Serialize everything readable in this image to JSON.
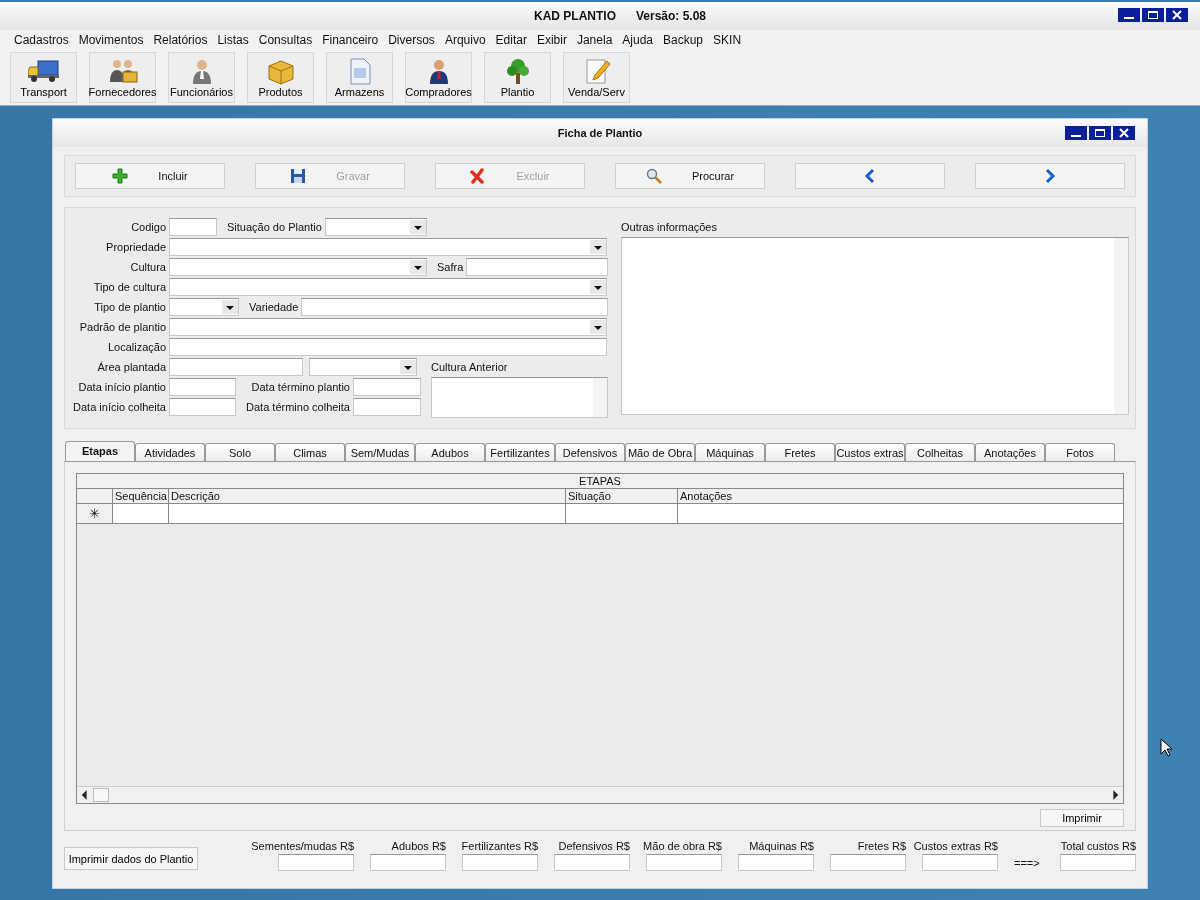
{
  "app": {
    "title": "KAD PLANTIO",
    "version": "Versão: 5.08"
  },
  "menu": [
    "Cadastros",
    "Movimentos",
    "Relatórios",
    "Listas",
    "Consultas",
    "Financeiro",
    "Diversos",
    "Arquivo",
    "Editar",
    "Exibir",
    "Janela",
    "Ajuda",
    "Backup",
    "SKIN"
  ],
  "toolbar": [
    "Transport",
    "Fornecedores",
    "Funcionários",
    "Produtos",
    "Armazens",
    "Compradores",
    "Plantio",
    "Venda/Serv"
  ],
  "window": {
    "title": "Ficha de Plantio"
  },
  "actions": [
    {
      "label": "Incluir",
      "disabled": false
    },
    {
      "label": "Gravar",
      "disabled": true
    },
    {
      "label": "Excluir",
      "disabled": true
    },
    {
      "label": "Procurar",
      "disabled": false
    },
    {
      "kind": "previous"
    },
    {
      "kind": "next"
    }
  ],
  "form": {
    "rows": [
      [
        {
          "kind": "label",
          "text": "Codigo"
        },
        {
          "kind": "field"
        },
        {
          "kind": "label",
          "text": "Situação do Plantio"
        },
        {
          "kind": "combo"
        }
      ],
      [
        {
          "kind": "label",
          "text": "Propriedade"
        },
        {
          "kind": "combo"
        }
      ],
      [
        {
          "kind": "label",
          "text": "Cultura"
        },
        {
          "kind": "combo"
        },
        {
          "kind": "label",
          "text": "Safra"
        },
        {
          "kind": "field"
        }
      ],
      [
        {
          "kind": "label",
          "text": "Tipo de cultura"
        },
        {
          "kind": "combo"
        }
      ],
      [
        {
          "kind": "label",
          "text": "Tipo de plantio"
        },
        {
          "kind": "combo"
        },
        {
          "kind": "label",
          "text": "Variedade"
        },
        {
          "kind": "field"
        }
      ],
      [
        {
          "kind": "label",
          "text": "Padrão de plantio"
        },
        {
          "kind": "combo"
        }
      ],
      [
        {
          "kind": "label",
          "text": "Localização"
        },
        {
          "kind": "field"
        }
      ]
    ],
    "lower_rows": [
      [
        {
          "kind": "label",
          "text": "Área plantada"
        },
        {
          "kind": "field"
        },
        {
          "kind": "combo"
        }
      ],
      [
        {
          "kind": "label",
          "text": "Data início plantio"
        },
        {
          "kind": "field"
        },
        {
          "kind": "label",
          "text": "Data término plantio"
        },
        {
          "kind": "field"
        }
      ],
      [
        {
          "kind": "label",
          "text": "Data início colheita"
        },
        {
          "kind": "field"
        },
        {
          "kind": "label",
          "text": "Data término colheita"
        },
        {
          "kind": "field"
        }
      ]
    ],
    "previous_crop_label": "Cultura Anterior",
    "notes_label": "Outras informações"
  },
  "tabs": [
    {
      "label": "Etapas",
      "selected": true
    },
    {
      "label": "Atividades",
      "selected": false
    },
    {
      "label": "Solo",
      "selected": false
    },
    {
      "label": "Climas",
      "selected": false
    },
    {
      "label": "Sem/Mudas",
      "selected": false
    },
    {
      "label": "Adubos",
      "selected": false
    },
    {
      "label": "Fertilizantes",
      "selected": false
    },
    {
      "label": "Defensivos",
      "selected": false
    },
    {
      "label": "Mão de Obra",
      "selected": false
    },
    {
      "label": "Máquinas",
      "selected": false
    },
    {
      "label": "Fretes",
      "selected": false
    },
    {
      "label": "Custos extras",
      "selected": false
    },
    {
      "label": "Colheitas",
      "selected": false
    },
    {
      "label": "Anotações",
      "selected": false
    },
    {
      "label": "Fotos",
      "selected": false
    }
  ],
  "grid": {
    "title": "ETAPAS",
    "columns": [
      "Sequência",
      "Descrição",
      "Situação",
      "Anotações"
    ],
    "new_row_marker": "✳"
  },
  "print_button": "Imprimir",
  "print_all_button": "Imprimir dados do Plantio",
  "totals": [
    "Sementes/mudas R$",
    "Adubos R$",
    "Fertilizantes R$",
    "Defensivos R$",
    "Mão de obra R$",
    "Máquinas R$",
    "Fretes R$",
    "Custos extras R$"
  ],
  "total_arrow": "===>",
  "grand_total": "Total custos R$"
}
